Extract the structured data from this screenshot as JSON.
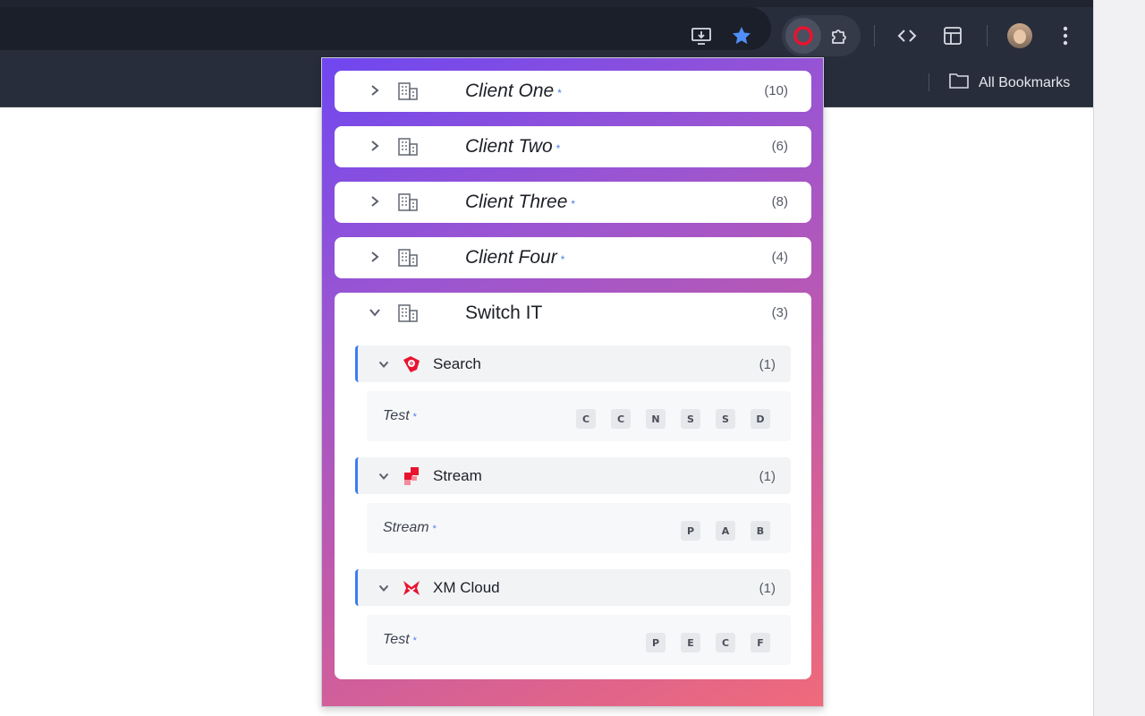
{
  "browser": {
    "bookmarks_label": "All Bookmarks",
    "icons": [
      "install-app-icon",
      "bookmark-star-icon",
      "extension-active-icon",
      "puzzle-icon",
      "code-icon",
      "side-panel-icon",
      "avatar",
      "kebab-menu-icon"
    ],
    "colors": {
      "chrome_bg": "#282d3b",
      "star": "#4f8ff7"
    }
  },
  "popup": {
    "colors": {
      "gradient_start": "#6f47f0",
      "gradient_end": "#f06a7a",
      "accent": "#3b7cf5"
    },
    "clients": [
      {
        "name": "Client One",
        "marker": "*",
        "count": "(10)"
      },
      {
        "name": "Client Two",
        "marker": "*",
        "count": "(6)"
      },
      {
        "name": "Client Three",
        "marker": "*",
        "count": "(8)"
      },
      {
        "name": "Client Four",
        "marker": "*",
        "count": "(4)"
      }
    ],
    "expanded_client": {
      "name": "Switch IT",
      "count": "(3)",
      "sections": [
        {
          "title": "Search",
          "icon": "search-product-icon",
          "count": "(1)",
          "row": {
            "name": "Test",
            "marker": "*",
            "chips": [
              "C",
              "C",
              "N",
              "S",
              "S",
              "D"
            ]
          }
        },
        {
          "title": "Stream",
          "icon": "stream-product-icon",
          "count": "(1)",
          "row": {
            "name": "Stream",
            "marker": "*",
            "chips": [
              "P",
              "A",
              "B"
            ]
          }
        },
        {
          "title": "XM Cloud",
          "icon": "xm-cloud-product-icon",
          "count": "(1)",
          "row": {
            "name": "Test",
            "marker": "*",
            "chips": [
              "P",
              "E",
              "C",
              "F"
            ]
          }
        }
      ]
    }
  }
}
